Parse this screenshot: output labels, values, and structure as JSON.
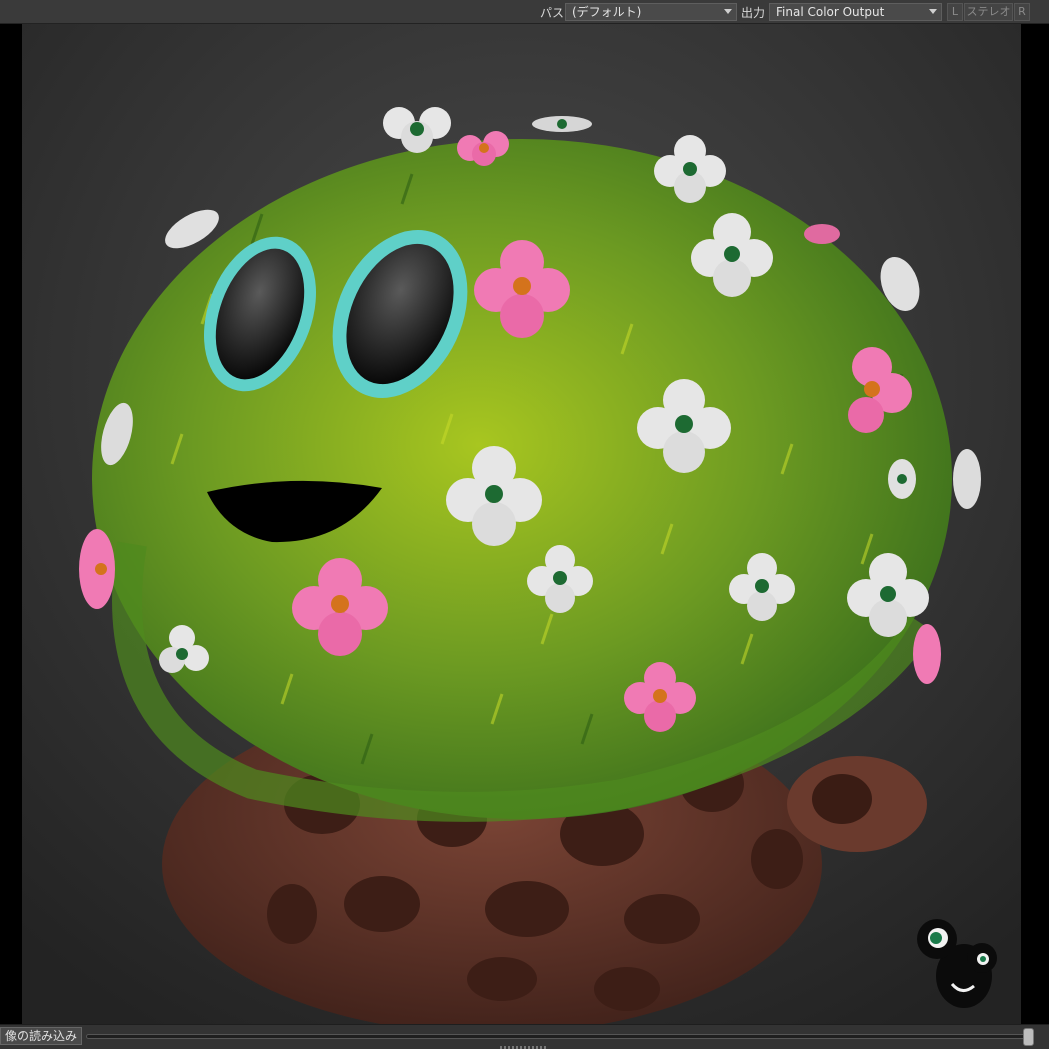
{
  "toolbar": {
    "pass_label": "パス",
    "pass_value": "(デフォルト)",
    "output_label": "出力",
    "output_value": "Final Color Output",
    "stereo_left": "L",
    "stereo_label": "ステレオ",
    "stereo_right": "R"
  },
  "bottom": {
    "load_button": "像の読み込み"
  },
  "colors": {
    "grass_dark": "#3f7a1e",
    "grass_light": "#b8d21e",
    "pot": "#6b3a2c",
    "flower_white": "#e8e8e8",
    "flower_pink": "#f07ab4",
    "eye_ring": "#5fd0c8"
  }
}
